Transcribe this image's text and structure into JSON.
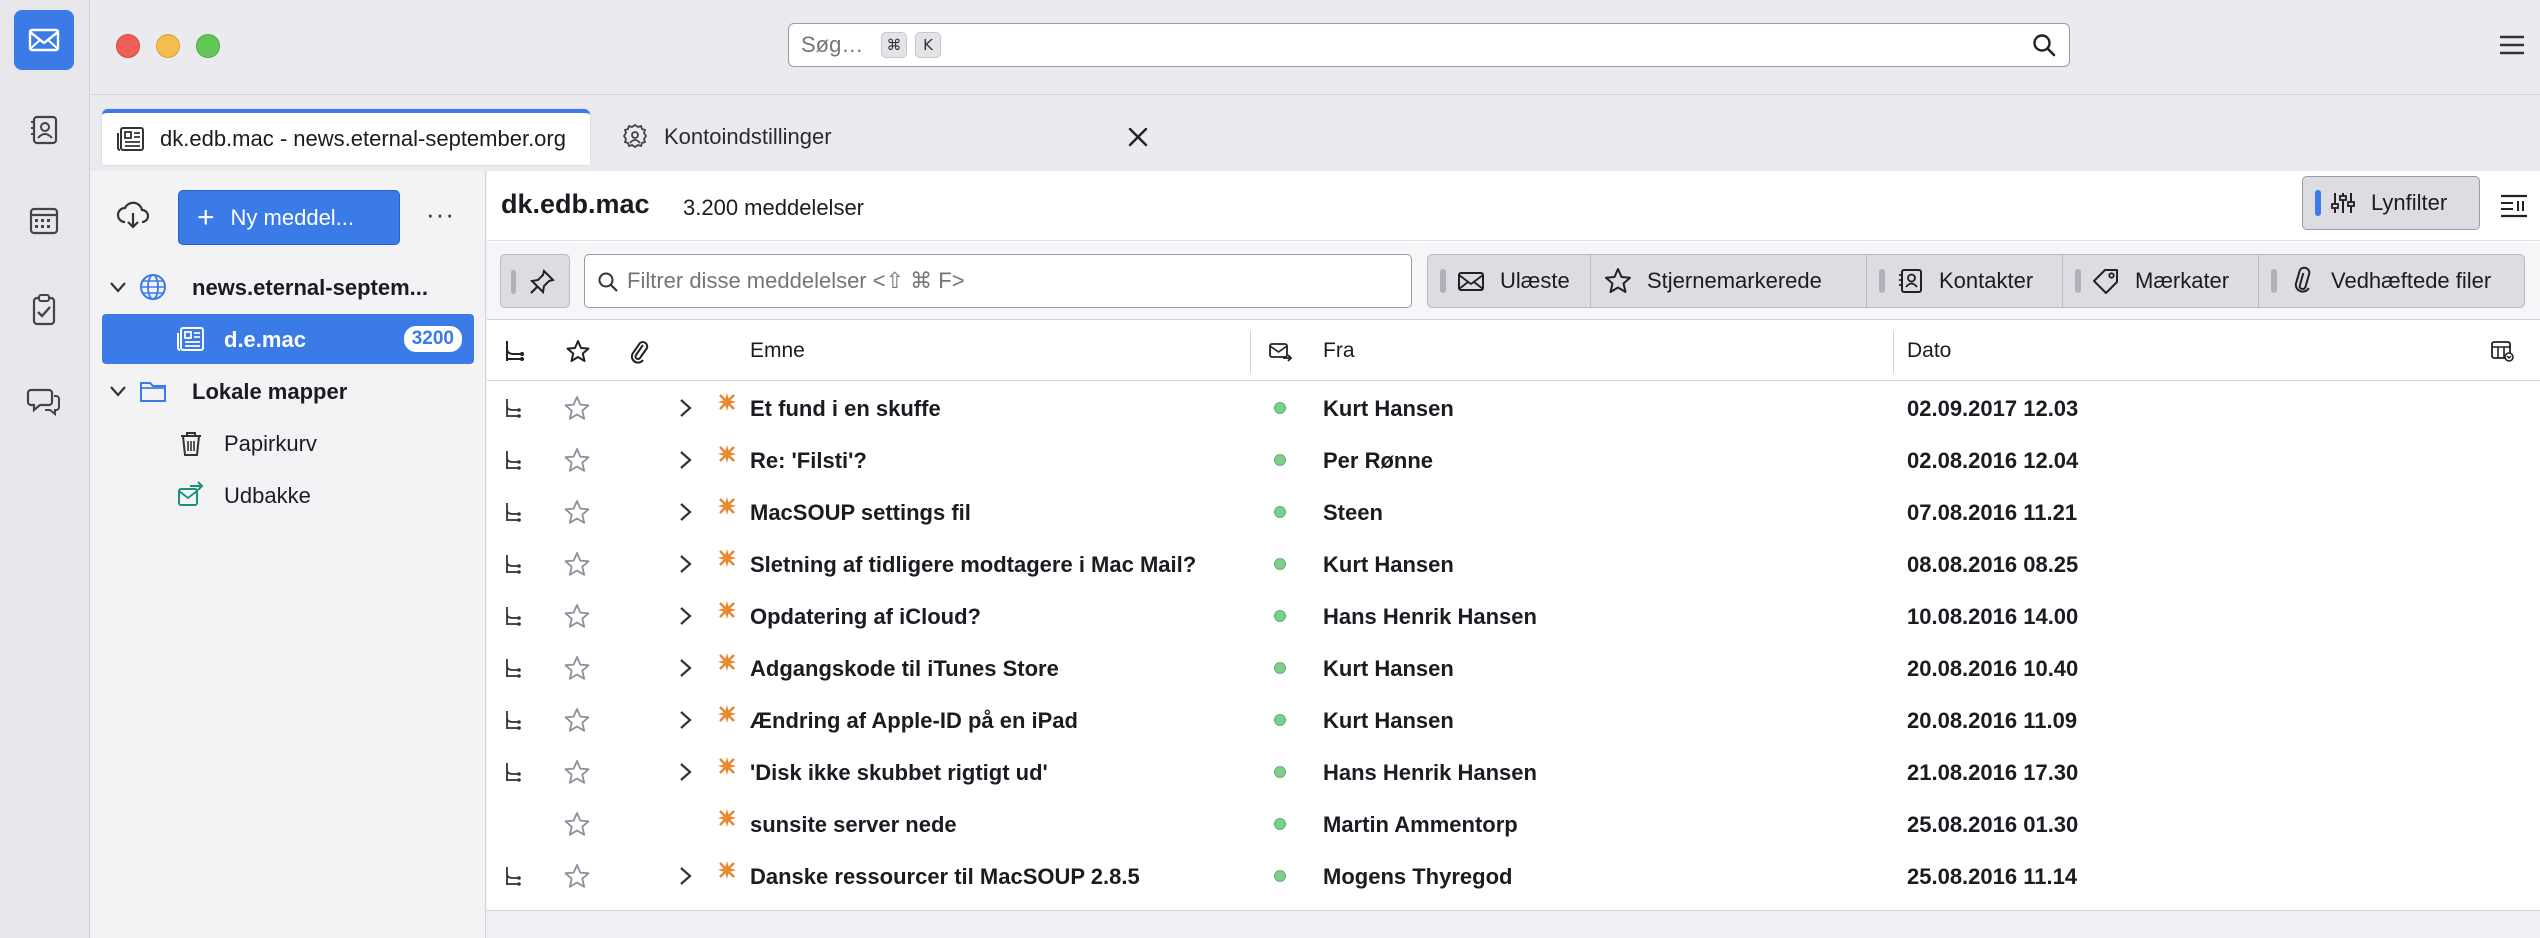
{
  "search": {
    "placeholder": "Søg…",
    "shortcut_cmd": "⌘",
    "shortcut_key": "K"
  },
  "tabs": [
    {
      "label": "dk.edb.mac - news.eternal-september.org"
    },
    {
      "label": "Kontoindstillinger"
    }
  ],
  "folderpane": {
    "new_message_label": "Ny meddel...",
    "more_label": "···",
    "account_label": "news.eternal-septem...",
    "newsgroup_label": "d.e.mac",
    "newsgroup_count": "3200",
    "local_label": "Lokale mapper",
    "trash_label": "Papirkurv",
    "outbox_label": "Udbakke"
  },
  "threadpane": {
    "folder_name": "dk.edb.mac",
    "message_count": "3.200 meddelelser",
    "quickfilter_label": "Lynfilter",
    "filter_placeholder": "Filtrer disse meddelelser <⇧ ⌘ F>",
    "filters": {
      "unread": "Ulæste",
      "starred": "Stjernemarkerede",
      "contacts": "Kontakter",
      "tags": "Mærkater",
      "attachments": "Vedhæftede filer"
    },
    "columns": {
      "subject": "Emne",
      "from": "Fra",
      "date": "Dato"
    }
  },
  "messages": [
    {
      "subject": "Et fund i en skuffe",
      "from": "Kurt Hansen",
      "date": "02.09.2017 12.03",
      "thread": true
    },
    {
      "subject": "Re: 'Filsti'?",
      "from": "Per Rønne",
      "date": "02.08.2016 12.04",
      "thread": true
    },
    {
      "subject": "MacSOUP settings fil",
      "from": "Steen",
      "date": "07.08.2016 11.21",
      "thread": true
    },
    {
      "subject": "Sletning af tidligere modtagere i Mac Mail?",
      "from": "Kurt Hansen",
      "date": "08.08.2016 08.25",
      "thread": true
    },
    {
      "subject": "Opdatering af iCloud?",
      "from": "Hans Henrik Hansen",
      "date": "10.08.2016 14.00",
      "thread": true
    },
    {
      "subject": "Adgangskode til iTunes Store",
      "from": "Kurt Hansen",
      "date": "20.08.2016 10.40",
      "thread": true
    },
    {
      "subject": "Ændring af Apple-ID på en iPad",
      "from": "Kurt Hansen",
      "date": "20.08.2016 11.09",
      "thread": true
    },
    {
      "subject": "'Disk ikke skubbet rigtigt ud'",
      "from": "Hans Henrik Hansen",
      "date": "21.08.2016 17.30",
      "thread": true
    },
    {
      "subject": "sunsite server nede",
      "from": "Martin Ammentorp",
      "date": "25.08.2016 01.30",
      "thread": false
    },
    {
      "subject": "Danske ressourcer til MacSOUP 2.8.5",
      "from": "Mogens Thyregod",
      "date": "25.08.2016 11.14",
      "thread": true
    }
  ],
  "colors": {
    "accent": "#3a7be8",
    "new_marker": "#e7892f",
    "online_dot": "#7ccf8a"
  }
}
